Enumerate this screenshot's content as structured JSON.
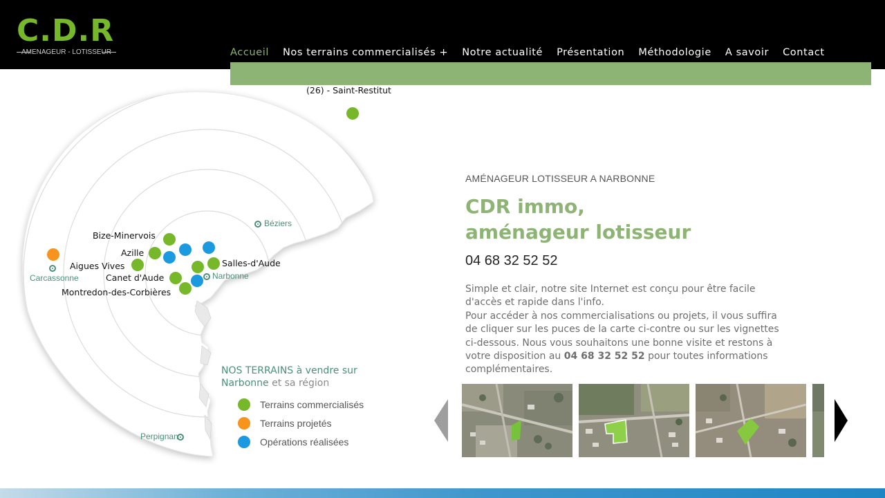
{
  "brand": {
    "logo_text": "C.D.R",
    "logo_subtitle": "AMENAGEUR - LOTISSEUR"
  },
  "nav": {
    "items": [
      {
        "label": "Accueil",
        "active": true
      },
      {
        "label": "Nos terrains commercialisés  +",
        "active": false
      },
      {
        "label": "Notre actualité",
        "active": false
      },
      {
        "label": "Présentation",
        "active": false
      },
      {
        "label": "Méthodologie",
        "active": false
      },
      {
        "label": "A savoir",
        "active": false
      },
      {
        "label": "Contact",
        "active": false
      }
    ]
  },
  "map": {
    "cities": {
      "beziers": "Béziers",
      "carcassonne": "Carcassonne",
      "narbonne": "Narbonne",
      "perpignan": "Perpignan"
    },
    "places": {
      "saint_restitut": "(26) - Saint-Restitut",
      "bize": "Bize-Minervois",
      "azille": "Azille",
      "aigues_vives": "Aigues  Vives",
      "canet": "Canet  d'Aude",
      "montredon": "Montredon-des-Corbières",
      "salles": "Salles-d'Aude"
    },
    "legend": {
      "title_main": "NOS TERRAINS à vendre sur Narbonne",
      "title_tail": " et sa région",
      "items": [
        "Terrains commercialisés",
        "Terrains projetés",
        "Opérations réalisées"
      ]
    },
    "colors": {
      "commercialises": "#76b82a",
      "projetes": "#f7941d",
      "realisees": "#1b9ae0"
    }
  },
  "intro": {
    "kicker": "AMÉNAGEUR LOTISSEUR A NARBONNE",
    "title_line1": "CDR immo,",
    "title_line2": "aménageur lotisseur",
    "phone": "04 68 32 52 52",
    "body_part1": "Simple et clair, notre site Internet est conçu pour être facile d'accès et rapide dans l'info.",
    "body_part2": "Pour accéder à nos commercialisations ou projets, il vous suffira de cliquer sur les puces de la carte ci-contre ou sur les vignettes ci-dessous. Nous vous souhaitons une bonne visite et restons à votre disposition au ",
    "body_phone": "04 68 32 52 52",
    "body_part3": " pour toutes informations complémentaires."
  },
  "carousel": {
    "thumbs": [
      "aerial-photo-1",
      "aerial-photo-2",
      "aerial-photo-3",
      "aerial-photo-4"
    ]
  },
  "theme": {
    "accent_green": "#8db375",
    "logo_green": "#76b82a",
    "header_bg": "#000000"
  }
}
